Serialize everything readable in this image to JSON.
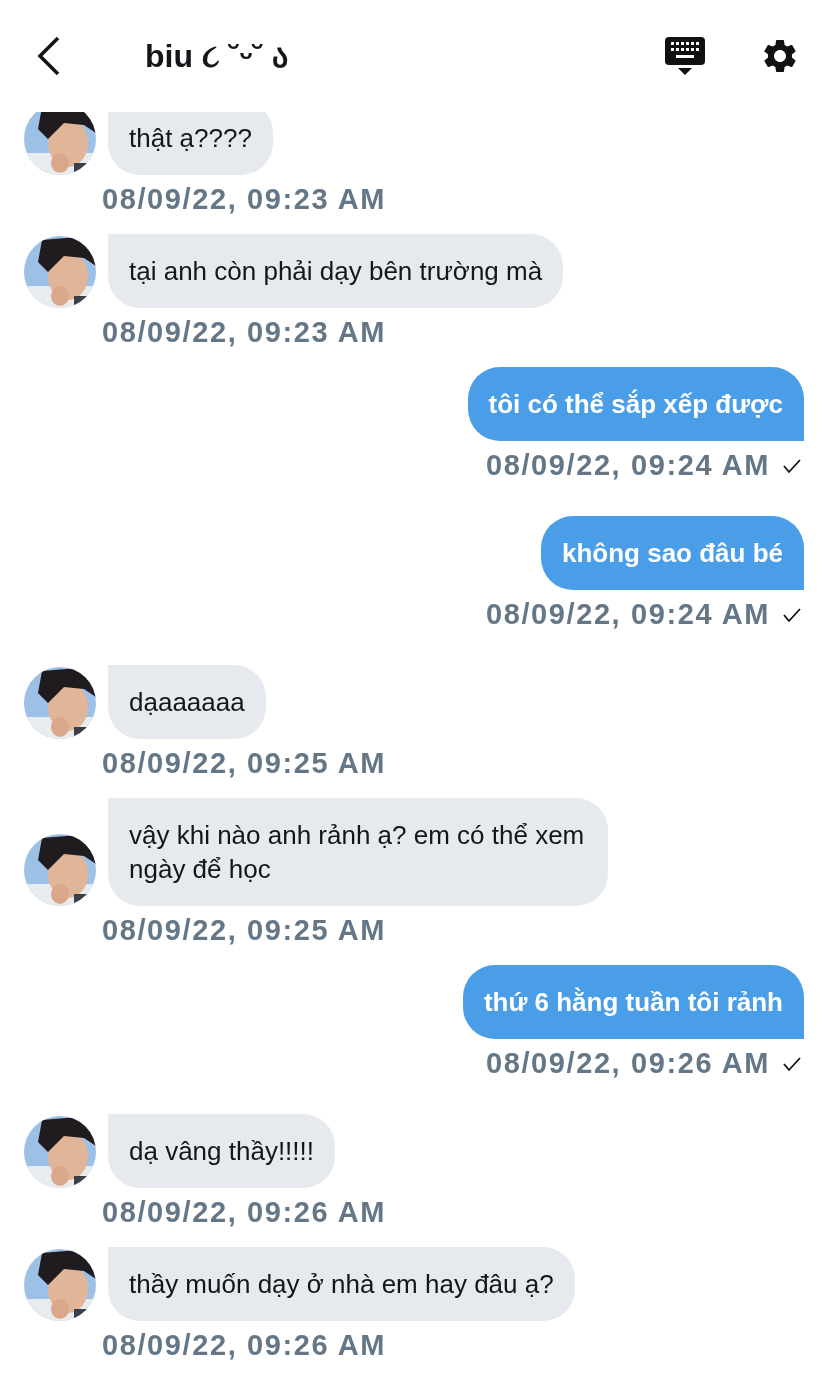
{
  "header": {
    "title": "biu ૮ ˘ᵕ˘ ა"
  },
  "messages": [
    {
      "kind": "incoming",
      "text": "thật ạ????",
      "time": "08/09/22, 09:23 AM",
      "delivered": false
    },
    {
      "kind": "incoming",
      "text": "tại anh còn phải dạy bên trường mà",
      "time": "08/09/22, 09:23 AM",
      "delivered": false
    },
    {
      "kind": "outgoing",
      "text": "tôi có thể sắp xếp được",
      "time": "08/09/22, 09:24 AM",
      "delivered": true
    },
    {
      "kind": "outgoing",
      "text": "không sao đâu bé",
      "time": "08/09/22, 09:24 AM",
      "delivered": true
    },
    {
      "kind": "incoming",
      "text": "dạaaaaaa",
      "time": "08/09/22, 09:25 AM",
      "delivered": false
    },
    {
      "kind": "incoming",
      "text": "vậy khi nào anh rảnh ạ? em có thể xem ngày để học",
      "time": "08/09/22, 09:25 AM",
      "delivered": false
    },
    {
      "kind": "outgoing",
      "text": "thứ 6 hằng tuần tôi rảnh",
      "time": "08/09/22, 09:26 AM",
      "delivered": true
    },
    {
      "kind": "incoming",
      "text": "dạ vâng thầy!!!!!",
      "time": "08/09/22, 09:26 AM",
      "delivered": false
    },
    {
      "kind": "incoming",
      "text": "thầy muốn dạy ở nhà em hay đâu ạ?",
      "time": "08/09/22, 09:26 AM",
      "delivered": false
    }
  ]
}
